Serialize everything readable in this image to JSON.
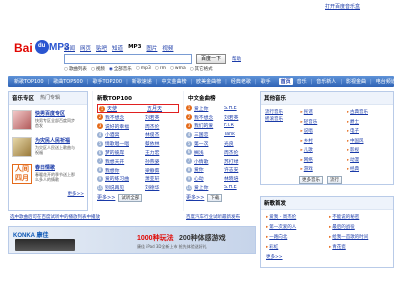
{
  "header": {
    "top_right_link": "打开百度音乐盒",
    "logo": {
      "bai": "Bai",
      "du": "du",
      "mp3": "MP3"
    },
    "nav_links": [
      "新闻",
      "网页",
      "贴吧",
      "知道",
      "MP3",
      "图片",
      "视频"
    ],
    "selected_nav": "MP3",
    "search_value": "",
    "search_button": "百度一下",
    "search_help": "帮助",
    "radio_options": [
      "歌曲列表",
      "视频",
      "全部音乐",
      "mp3",
      "rm",
      "wma",
      "其它格式"
    ],
    "radio_selected": "全部音乐"
  },
  "navbar": {
    "items": [
      "新歌TOP100",
      "歌曲TOP500",
      "歌手TOP200",
      "新歌速递",
      "中文金曲榜",
      "欧美金曲榜",
      "经典老歌",
      "歌手",
      "音乐"
    ],
    "right_items": [
      "首页",
      "音乐",
      "音乐新人",
      "影视金曲",
      "电台频道"
    ],
    "home": "首页"
  },
  "left": {
    "title": "音乐专区",
    "tab2": "热门专辑",
    "hot": [
      {
        "title": "快男百度专区",
        "desc": "快男专区全部百度同步首发"
      },
      {
        "title": "为灾民人民祈福",
        "desc": "为灾区人民送上歌曲与祝福"
      },
      {
        "title": "春日情歌",
        "desc": "春暖花开的季节送上那么多人的情歌"
      }
    ],
    "more": "更多>>"
  },
  "toplist": {
    "title": "新歌TOP100",
    "rows": [
      {
        "n": "1",
        "song": "天使",
        "singer": "五月天"
      },
      {
        "n": "2",
        "song": "我不想念",
        "singer": "刘若英"
      },
      {
        "n": "3",
        "song": "说好的幸福",
        "singer": "周杰伦"
      },
      {
        "n": "4",
        "song": "小酒窝",
        "singer": "林俊杰"
      },
      {
        "n": "5",
        "song": "情歌唱一唱",
        "singer": "蔡依林"
      },
      {
        "n": "6",
        "song": "梦的彼岸",
        "singer": "王力宏"
      },
      {
        "n": "7",
        "song": "我想天开",
        "singer": "孙燕姿"
      },
      {
        "n": "8",
        "song": "我想你",
        "singer": "梁静茹"
      },
      {
        "n": "9",
        "song": "爱的练习曲",
        "singer": "萧亚轩"
      },
      {
        "n": "10",
        "song": "别说再见",
        "singer": "刘德华"
      }
    ],
    "more": "更多>>"
  },
  "chinese": {
    "title": "中文金曲榜",
    "prefix": "",
    "rows": [
      {
        "n": "1",
        "song": "爱上你",
        "singer": "S.H.E"
      },
      {
        "n": "2",
        "song": "我不想念",
        "singer": "刘若英"
      },
      {
        "n": "3",
        "song": "我们的爱",
        "singer": "F.I.R"
      },
      {
        "n": "4",
        "song": "三国恋",
        "singer": "Tank"
      },
      {
        "n": "5",
        "song": "第一次",
        "singer": "光良"
      },
      {
        "n": "6",
        "song": "搁浅",
        "singer": "周杰伦"
      },
      {
        "n": "7",
        "song": "小情歌",
        "singer": "苏打绿"
      },
      {
        "n": "8",
        "song": "爱你",
        "singer": "许志安"
      },
      {
        "n": "9",
        "song": "心动",
        "singer": "林晓培"
      },
      {
        "n": "10",
        "song": "爱上你",
        "singer": "S.H.E"
      }
    ],
    "more": "更多>>"
  },
  "right_panel": {
    "title": "其他音乐",
    "sub": [
      "流行音乐",
      "摇滚音乐"
    ],
    "links": [
      "民谣",
      "古典音乐",
      "轻音乐",
      "爵士",
      "说唱",
      "电子",
      "乡村",
      "中国风",
      "儿歌",
      "影视",
      "网络",
      "动漫",
      "游戏",
      "经典",
      "DJ",
      "戏曲"
    ],
    "btn1": "更多音乐",
    "btn2": "流行"
  },
  "right_news": {
    "title": "新歌首发",
    "rows": [
      "爱我 - 周杰伦",
      "不能说的秘密",
      "第一次爱的人",
      "最后的战役",
      "一路向北",
      "给我一首歌的时间",
      "彩虹",
      "青花瓷",
      "千里之外",
      "蒲公英的约定"
    ],
    "more": "更多>>"
  },
  "bottom": {
    "link_left": "选中歌曲后可在百度试听中的播放列表中播放",
    "link_mid": "百度汽车行业试听最新发布",
    "banner_brand": "KONKA 康佳",
    "banner_text1": "1000种玩法",
    "banner_text2": "200种体感游戏",
    "banner_sub": "康佳 iPad 3D全新上市 抢先体验送好礼",
    "btn_test": "试听全部",
    "btn_down": "下载"
  }
}
